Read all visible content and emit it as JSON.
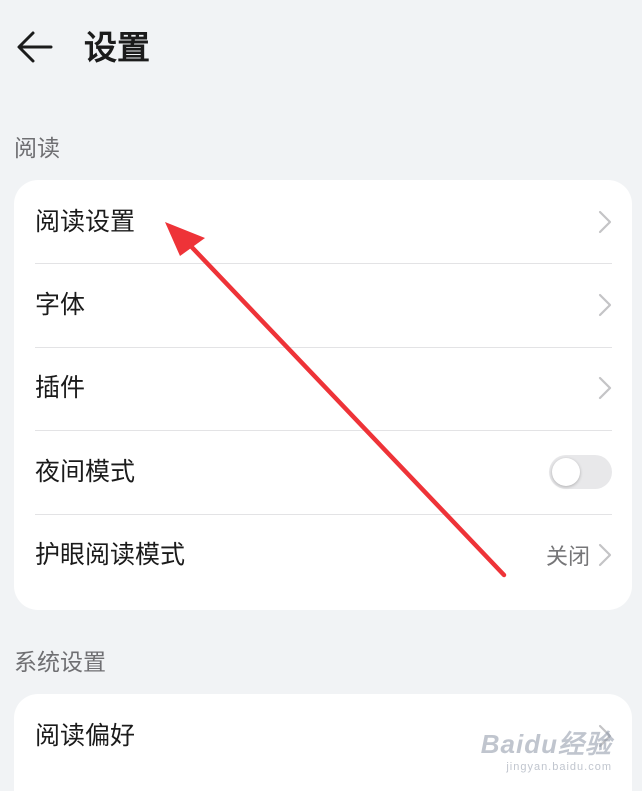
{
  "header": {
    "title": "设置"
  },
  "sections": [
    {
      "label": "阅读",
      "items": [
        {
          "label": "阅读设置"
        },
        {
          "label": "字体"
        },
        {
          "label": "插件"
        },
        {
          "label": "夜间模式",
          "toggle": false
        },
        {
          "label": "护眼阅读模式",
          "value": "关闭"
        }
      ]
    },
    {
      "label": "系统设置",
      "items": [
        {
          "label": "阅读偏好"
        }
      ]
    }
  ],
  "watermark": {
    "main": "Baidu经验",
    "sub": "jingyan.baidu.com"
  },
  "colors": {
    "background": "#f1f3f5",
    "card": "#ffffff",
    "arrow": "#ee3338",
    "toggle_off": "#e8e8ea"
  }
}
